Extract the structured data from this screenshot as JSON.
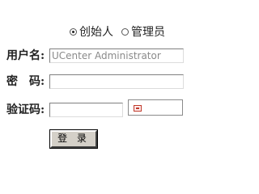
{
  "role_options": [
    {
      "label": "创始人",
      "checked": true
    },
    {
      "label": "管理员",
      "checked": false
    }
  ],
  "fields": {
    "username": {
      "label": "用户名:",
      "value": "UCenter Administrator"
    },
    "password": {
      "label": "密　码:",
      "value": ""
    },
    "captcha": {
      "label": "验证码:",
      "value": ""
    }
  },
  "submit_label": "登 录"
}
